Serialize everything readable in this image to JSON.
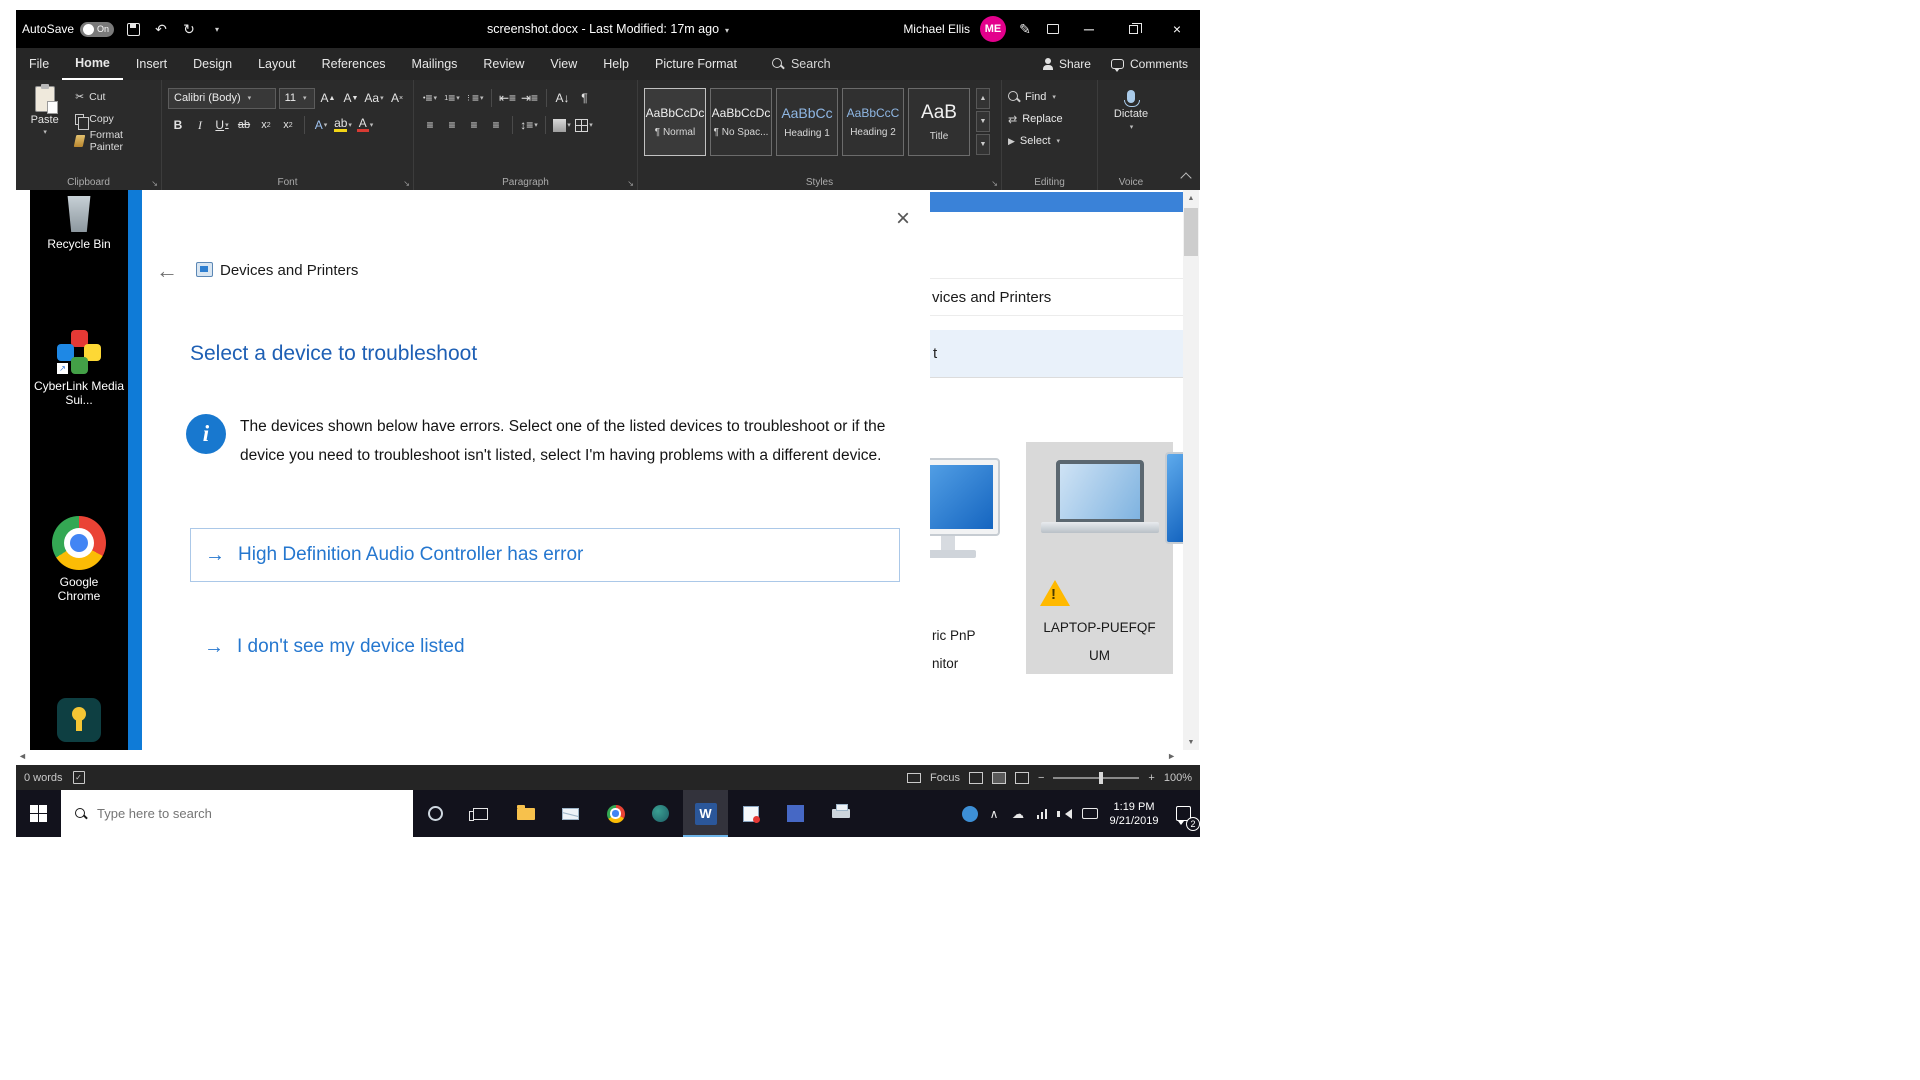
{
  "titlebar": {
    "autosave_label": "AutoSave",
    "autosave_state": "On",
    "doc_title": "screenshot.docx - Last Modified: 17m ago",
    "user_name": "Michael Ellis",
    "user_initials": "ME"
  },
  "ribbon": {
    "tabs": [
      "File",
      "Home",
      "Insert",
      "Design",
      "Layout",
      "References",
      "Mailings",
      "Review",
      "View",
      "Help",
      "Picture Format"
    ],
    "active_tab": "Home",
    "search_label": "Search",
    "share_label": "Share",
    "comments_label": "Comments",
    "clipboard": {
      "group_label": "Clipboard",
      "paste": "Paste",
      "cut": "Cut",
      "copy": "Copy",
      "format_painter": "Format Painter"
    },
    "font": {
      "group_label": "Font",
      "font_name": "Calibri (Body)",
      "font_size": "11"
    },
    "paragraph": {
      "group_label": "Paragraph"
    },
    "styles": {
      "group_label": "Styles",
      "items": [
        {
          "preview": "AaBbCcDc",
          "name": "¶ Normal"
        },
        {
          "preview": "AaBbCcDc",
          "name": "¶ No Spac..."
        },
        {
          "preview": "AaBbCc",
          "name": "Heading 1"
        },
        {
          "preview": "AaBbCcC",
          "name": "Heading 2"
        },
        {
          "preview": "AaB",
          "name": "Title"
        }
      ]
    },
    "editing": {
      "group_label": "Editing",
      "find": "Find",
      "replace": "Replace",
      "select": "Select"
    },
    "voice": {
      "group_label": "Voice",
      "dictate": "Dictate"
    }
  },
  "desktop": {
    "icons": [
      {
        "label": "Recycle Bin"
      },
      {
        "label": "CyberLink Media Sui..."
      },
      {
        "label": "Google Chrome"
      }
    ]
  },
  "dialog": {
    "window_title": "Devices and Printers",
    "heading": "Select a device to troubleshoot",
    "info_text": "The devices shown below have errors. Select one of the listed devices to troubleshoot or if the device you need to troubleshoot isn't listed, select I'm having problems with a different device.",
    "options": [
      {
        "label": "High Definition Audio Controller has error"
      },
      {
        "label": "I don't see my device listed"
      }
    ]
  },
  "background_window": {
    "breadcrumb_fragment": "vices and Printers",
    "row_fragment": "t",
    "monitor_label_line1": "ric PnP",
    "monitor_label_line2": "nitor",
    "laptop_label_line1": "LAPTOP-PUEFQF",
    "laptop_label_line2": "UM"
  },
  "statusbar": {
    "word_count": "0 words",
    "focus_label": "Focus",
    "zoom_level": "100%"
  },
  "taskbar": {
    "search_placeholder": "Type here to search",
    "clock_time": "1:19 PM",
    "clock_date": "9/21/2019",
    "notification_count": "2"
  }
}
